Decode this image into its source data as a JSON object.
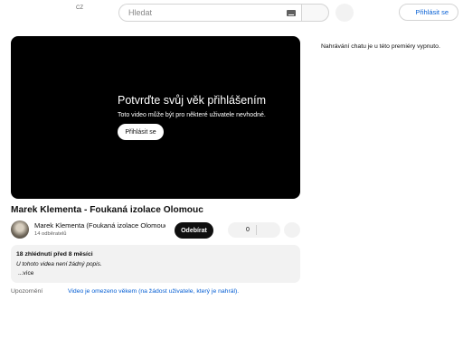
{
  "header": {
    "region": "CZ",
    "search_placeholder": "Hledat",
    "signin_label": "Přihlásit se"
  },
  "player": {
    "age_title": "Potvrďte svůj věk přihlášením",
    "age_subtitle": "Toto video může být pro některé uživatele nevhodné.",
    "signin_label": "Přihlásit se"
  },
  "chat": {
    "note": "Nahrávání chatu je u této premiéry vypnuto."
  },
  "video": {
    "title": "Marek Klementa - Foukaná izolace Olomouc"
  },
  "channel": {
    "name": "Marek Klementa (Foukaná izolace Olomouc)",
    "subscribers": "14 odběratelů",
    "subscribe_label": "Odebírat",
    "like_count": "0"
  },
  "description": {
    "meta": "18 zhlédnutí  před 8 měsíci",
    "text": "U tohoto videa není žádný popis.",
    "more_label": "...více"
  },
  "notice": {
    "label": "Upozornění",
    "link": "Video je omezeno věkem (na žádost uživatele, který je nahrál)."
  }
}
